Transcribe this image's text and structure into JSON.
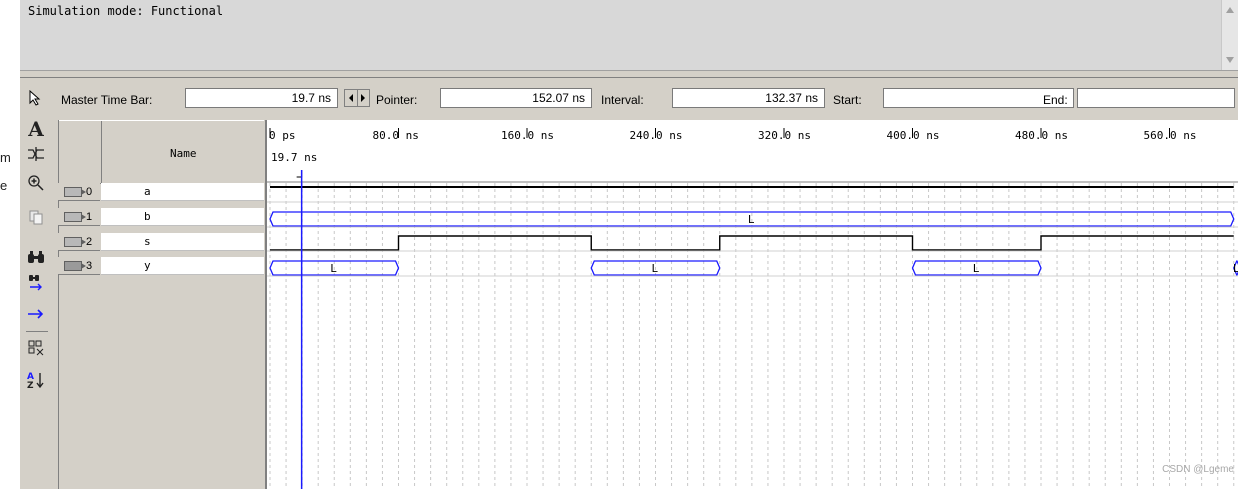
{
  "left_fragments": [
    "m",
    "e"
  ],
  "message_pane": {
    "text": "Simulation mode: Functional"
  },
  "toolbar": {
    "master_time_bar_label": "Master Time Bar:",
    "master_time_bar_value": "19.7 ns",
    "pointer_label": "Pointer:",
    "pointer_value": "152.07 ns",
    "interval_label": "Interval:",
    "interval_value": "132.37 ns",
    "start_label": "Start:",
    "start_value": "",
    "end_label": "End:",
    "end_value": ""
  },
  "vertical_tools": [
    "select-arrow-icon",
    "text-tool-icon",
    "waveform-edit-icon",
    "zoom-icon",
    "copy-icon",
    "find-icon",
    "find-next-icon",
    "goto-arrow-icon",
    "grid-snap-icon",
    "sort-icon"
  ],
  "name_column": {
    "header": "Name"
  },
  "signals": [
    {
      "index": "0",
      "name": "a",
      "direction": "in"
    },
    {
      "index": "1",
      "name": "b",
      "direction": "in"
    },
    {
      "index": "2",
      "name": "s",
      "direction": "in"
    },
    {
      "index": "3",
      "name": "y",
      "direction": "out"
    }
  ],
  "timeline": {
    "ticks": [
      "0 ps",
      "80.0 ns",
      "160.0 ns",
      "240.0 ns",
      "320.0 ns",
      "400.0 ns",
      "480.0 ns",
      "560.0 ns"
    ],
    "cursor_label": "19.7 ns",
    "cursor_time_ns": 19.7,
    "ns_per_major_tick": 80
  },
  "waveforms": {
    "a": {
      "kind": "level",
      "segments": [
        {
          "from_ns": 0,
          "to_ns": 600,
          "level": 1
        }
      ]
    },
    "b": {
      "kind": "bus",
      "segments": [
        {
          "from_ns": 0,
          "to_ns": 600,
          "label": "L"
        }
      ]
    },
    "s": {
      "kind": "level",
      "segments": [
        {
          "from_ns": 0,
          "to_ns": 80,
          "level": 0
        },
        {
          "from_ns": 80,
          "to_ns": 200,
          "level": 1
        },
        {
          "from_ns": 200,
          "to_ns": 280,
          "level": 0
        },
        {
          "from_ns": 280,
          "to_ns": 400,
          "level": 1
        },
        {
          "from_ns": 400,
          "to_ns": 480,
          "level": 0
        },
        {
          "from_ns": 480,
          "to_ns": 600,
          "level": 1
        }
      ]
    },
    "y": {
      "kind": "mixed",
      "segments": [
        {
          "from_ns": 0,
          "to_ns": 80,
          "label": "L"
        },
        {
          "from_ns": 80,
          "to_ns": 200,
          "level": 1
        },
        {
          "from_ns": 200,
          "to_ns": 280,
          "label": "L"
        },
        {
          "from_ns": 280,
          "to_ns": 400,
          "level": 1
        },
        {
          "from_ns": 400,
          "to_ns": 480,
          "label": "L"
        },
        {
          "from_ns": 480,
          "to_ns": 600,
          "level": 1
        },
        {
          "from_ns": 600,
          "to_ns": 604,
          "label": "L"
        }
      ]
    }
  },
  "colors": {
    "cursor": "#1a1aff",
    "bus": "#1a1aff",
    "signal": "#000000",
    "grid": "#c8c8c8"
  },
  "watermark": "CSDN @Lgeme"
}
